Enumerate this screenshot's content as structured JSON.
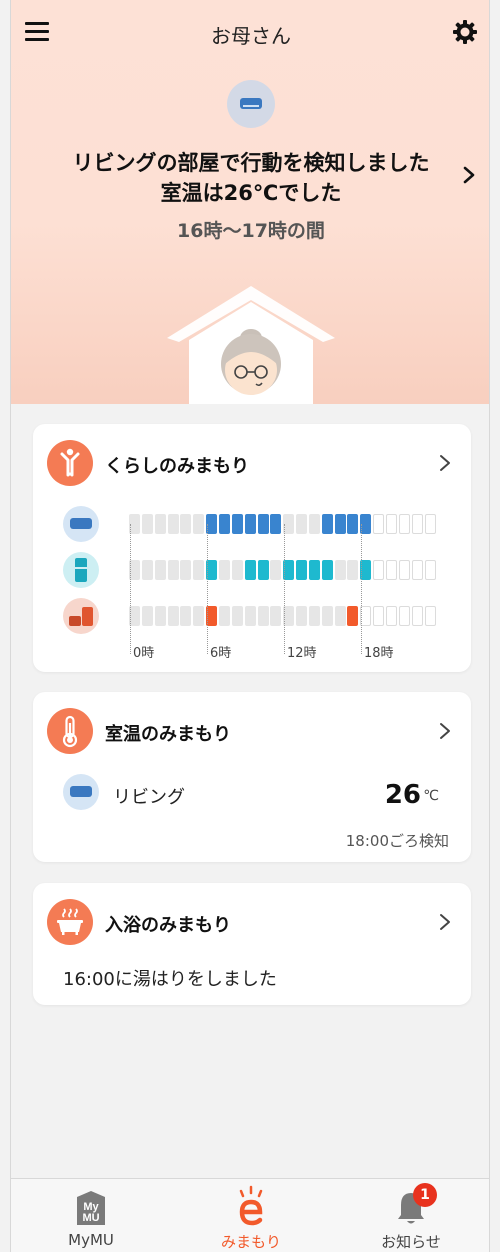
{
  "header": {
    "title": "お母さん"
  },
  "hero": {
    "message_line1": "リビングの部屋で行動を検知しました",
    "message_line2": "室温は26℃でした",
    "time_range": "16時〜17時の間"
  },
  "colors": {
    "accent": "#f25a2b",
    "ac_blue": "#3984cf",
    "fridge_teal": "#1eb9cf",
    "hero_bg": "#fde1d6"
  },
  "living_card": {
    "title": "くらしのみまもり",
    "icons": [
      "aircon-icon",
      "fridge-icon",
      "rice-cooker-icon"
    ],
    "rows": [
      {
        "device": "aircon",
        "color": "blue",
        "active": [
          0,
          0,
          0,
          0,
          0,
          0,
          1,
          1,
          1,
          1,
          1,
          1,
          0,
          0,
          0,
          1,
          1,
          1,
          1,
          0,
          0,
          0,
          0,
          0
        ],
        "recorded_hours": 19
      },
      {
        "device": "fridge",
        "color": "teal",
        "active": [
          0,
          0,
          0,
          0,
          0,
          0,
          1,
          0,
          0,
          1,
          1,
          0,
          1,
          1,
          1,
          1,
          0,
          0,
          1,
          0,
          0,
          0,
          0,
          0
        ],
        "recorded_hours": 19
      },
      {
        "device": "rice_cooker",
        "color": "red",
        "active": [
          0,
          0,
          0,
          0,
          0,
          0,
          1,
          0,
          0,
          0,
          0,
          0,
          0,
          0,
          0,
          0,
          0,
          1,
          0,
          0,
          0,
          0,
          0,
          0
        ],
        "recorded_hours": 18
      }
    ],
    "ticks": [
      "0時",
      "6時",
      "12時",
      "18時"
    ]
  },
  "temp_card": {
    "title": "室温のみまもり",
    "room": "リビング",
    "value": "26",
    "unit": "℃",
    "detected": "18:00ごろ検知"
  },
  "bath_card": {
    "title": "入浴のみまもり",
    "message": "16:00に湯はりをしました"
  },
  "tabbar": {
    "tabs": [
      {
        "label": "MyMU",
        "icon": "mymu-icon"
      },
      {
        "label": "みまもり",
        "icon": "mimamori-e-icon"
      },
      {
        "label": "お知らせ",
        "icon": "bell-icon"
      }
    ],
    "active": "みまもり",
    "notification_count": "1"
  }
}
